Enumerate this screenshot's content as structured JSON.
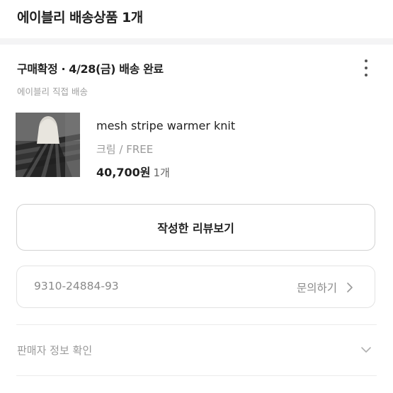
{
  "header": {
    "title": "에이블리 배송상품 1개"
  },
  "order": {
    "status": "구매확정 · 4/28(금) 배송 완료",
    "shipping_type": "에이블리 직접 배송",
    "more_icon": "kebab-vertical-icon"
  },
  "product": {
    "name": "mesh stripe warmer knit",
    "option": "크림 / FREE",
    "price": "40,700원",
    "quantity": "1개"
  },
  "actions": {
    "review_label": "작성한 리뷰보기"
  },
  "tracking": {
    "number": "9310-24884-93",
    "inquiry_label": "문의하기",
    "inquiry_icon": "chevron-right-icon"
  },
  "seller": {
    "label": "판매자 정보 확인",
    "expand_icon": "chevron-down-icon"
  }
}
